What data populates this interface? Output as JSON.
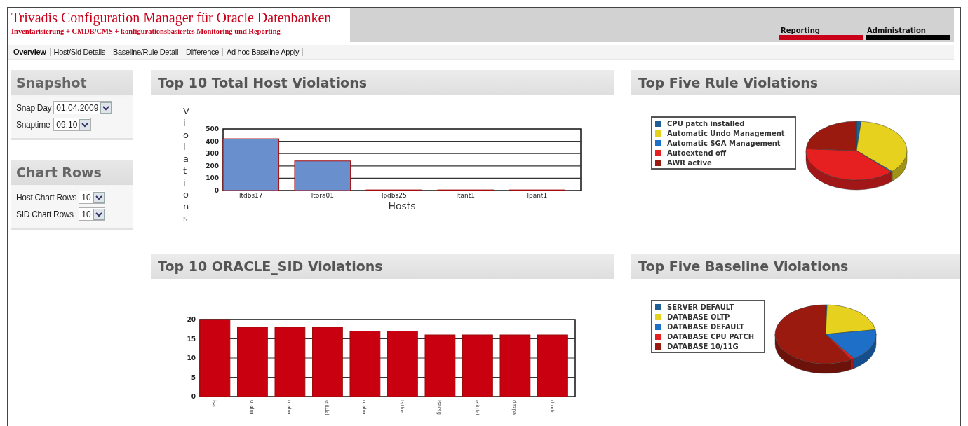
{
  "header": {
    "title": "Trivadis Configuration Manager für Oracle Datenbanken",
    "subtitle": "Inventarisierung + CMDB/CMS + konfigurationsbasiertes Monitoring und Reporting",
    "tabs": [
      {
        "label": "Reporting",
        "selected": true
      },
      {
        "label": "Administration",
        "selected": false
      }
    ]
  },
  "nav": {
    "links": [
      {
        "label": "Overview",
        "selected": true
      },
      {
        "label": "Host/Sid Details",
        "selected": false
      },
      {
        "label": "Baseline/Rule Detail",
        "selected": false
      },
      {
        "label": "Difference",
        "selected": false
      },
      {
        "label": "Ad hoc Baseline Apply",
        "selected": false
      }
    ]
  },
  "sidebar": {
    "panels": [
      {
        "title": "Snapshot",
        "fields": [
          {
            "label": "Snap Day",
            "value": "01.04.2009"
          },
          {
            "label": "Snaptime",
            "value": "09:10"
          }
        ]
      },
      {
        "title": "Chart Rows",
        "fields": [
          {
            "label": "Host Chart Rows",
            "value": "10"
          },
          {
            "label": "SID Chart Rows",
            "value": "10"
          }
        ]
      }
    ]
  },
  "panels": [
    {
      "title": "Top 10 Total Host Violations",
      "kind": "bar3d",
      "chart_data": {
        "type": "bar",
        "grid": true,
        "xlabel": "Hosts",
        "ylabel": "Violations",
        "categories": [
          "ltdbs17",
          "ltora01",
          "lpdbs25",
          "ltant1",
          "lpant1"
        ],
        "values": [
          420,
          240,
          5,
          5,
          5
        ],
        "ylim": [
          0,
          500
        ],
        "yticks": [
          0,
          100,
          200,
          300,
          400,
          500
        ]
      }
    },
    {
      "title": "Top Five Rule Violations",
      "kind": "pie",
      "legend": [
        {
          "label": "CPU patch installed",
          "color": "#1f5f96"
        },
        {
          "label": "Automatic Undo Management",
          "color": "#e6d21e"
        },
        {
          "label": "Automatic SGA Management",
          "color": "#1e6fc8"
        },
        {
          "label": "Autoextend off",
          "color": "#e62020"
        },
        {
          "label": "AWR active",
          "color": "#9a1a10"
        }
      ]
    },
    {
      "title": "Top 10 ORACLE_SID Violations",
      "kind": "bar3d",
      "chart_data": {
        "type": "bar",
        "grid": true,
        "categories": [
          "isa",
          "oralm",
          "oralm",
          "elitdal",
          "oralm",
          "tsthe",
          "isarsg",
          "elitdal",
          "dezpa",
          "dmdc"
        ],
        "values": [
          20,
          18,
          18,
          18,
          17,
          17,
          16,
          16,
          16,
          16
        ],
        "ylim": [
          0,
          20
        ],
        "yticks": [
          0,
          5,
          10,
          15,
          20
        ]
      }
    },
    {
      "title": "Top Five Baseline Violations",
      "kind": "pie",
      "legend": [
        {
          "label": "SERVER DEFAULT",
          "color": "#1f5f96"
        },
        {
          "label": "DATABASE OLTP",
          "color": "#e6d21e"
        },
        {
          "label": "DATABASE DEFAULT",
          "color": "#1e6fc8"
        },
        {
          "label": "DATABASE CPU PATCH",
          "color": "#e62020"
        },
        {
          "label": "DATABASE 10/11G",
          "color": "#9a1a10"
        }
      ]
    }
  ]
}
